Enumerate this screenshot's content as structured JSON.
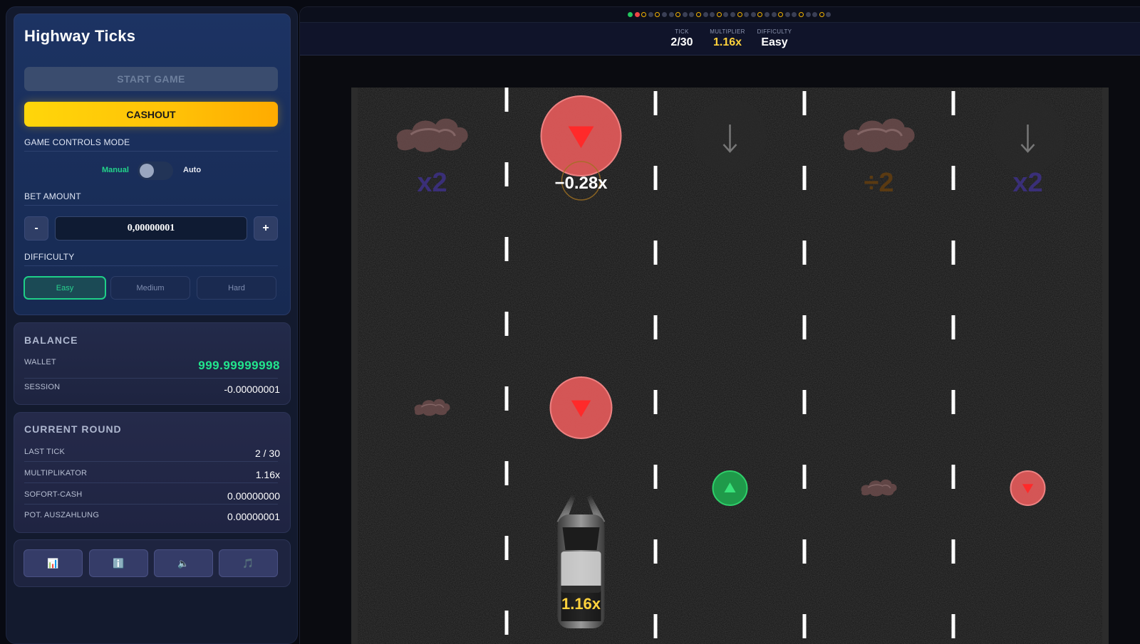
{
  "game": {
    "title": "Highway Ticks",
    "start_label": "START GAME",
    "cashout_label": "CASHOUT",
    "controls_mode_label": "GAME CONTROLS MODE",
    "mode_manual": "Manual",
    "mode_auto": "Auto",
    "mode_selected": "manual",
    "bet_amount_label": "BET AMOUNT",
    "bet_minus": "-",
    "bet_plus": "+",
    "bet_value": "0,00000001",
    "difficulty_label": "DIFFICULTY",
    "difficulties": [
      "Easy",
      "Medium",
      "Hard"
    ],
    "difficulty_selected": "Easy"
  },
  "balance": {
    "heading": "BALANCE",
    "wallet_label": "WALLET",
    "wallet_value": "999.99999998",
    "session_label": "SESSION",
    "session_value": "-0.00000001"
  },
  "round": {
    "heading": "CURRENT ROUND",
    "last_tick_label": "LAST TICK",
    "last_tick_value": "2 / 30",
    "multiplier_label": "MULTIPLIKATOR",
    "multiplier_value": "1.16x",
    "instant_cash_label": "SOFORT-CASH",
    "instant_cash_value": "0.00000000",
    "payout_label": "POT. AUSZAHLUNG",
    "payout_value": "0.00000001"
  },
  "tools": [
    {
      "name": "stats-button",
      "icon": "bar-chart-icon",
      "glyph": "📊"
    },
    {
      "name": "info-button",
      "icon": "info-icon",
      "glyph": "ℹ️"
    },
    {
      "name": "sound-button",
      "icon": "speaker-icon",
      "glyph": "🔈"
    },
    {
      "name": "music-button",
      "icon": "music-note-icon",
      "glyph": "🎵"
    }
  ],
  "hud": {
    "tick_label": "TICK",
    "tick_value": "2/30",
    "multiplier_label": "MULTIPLIER",
    "multiplier_value": "1.16x",
    "difficulty_label": "DIFFICULTY",
    "difficulty_value": "Easy"
  },
  "progress": {
    "total_ticks": 30,
    "states": [
      "won",
      "lost",
      "pending-gold",
      "empty",
      "pending-gold",
      "empty",
      "empty",
      "pending-gold",
      "empty",
      "empty",
      "pending-gold",
      "empty",
      "empty",
      "pending-gold",
      "empty",
      "empty",
      "pending-gold",
      "empty",
      "empty",
      "pending-gold",
      "empty",
      "empty",
      "pending-gold",
      "empty",
      "empty",
      "pending-gold",
      "empty",
      "empty",
      "pending-gold",
      "empty"
    ],
    "colors": {
      "won": "#22c55e",
      "lost": "#ef4444",
      "pending-gold": "#f5b400",
      "empty": "#3a3f55"
    }
  },
  "road": {
    "lane_count": 5,
    "items": [
      {
        "lane": 0,
        "row": 0,
        "type": "oil",
        "label": "x2",
        "label_color": "#3a2f78"
      },
      {
        "lane": 1,
        "row": 0,
        "type": "hazard-red",
        "label": "−0.28x",
        "label_color": "#ffffff"
      },
      {
        "lane": 2,
        "row": 0,
        "type": "arrow-ghost"
      },
      {
        "lane": 3,
        "row": 0,
        "type": "oil",
        "label": "÷2",
        "label_color": "#5a3a12"
      },
      {
        "lane": 4,
        "row": 0,
        "type": "arrow-ghost",
        "label": "x2",
        "label_color": "#3a2f78"
      },
      {
        "lane": 0,
        "row": 1,
        "type": "oil-small"
      },
      {
        "lane": 1,
        "row": 1,
        "type": "hazard-red"
      },
      {
        "lane": 2,
        "row": 2,
        "type": "boost-green"
      },
      {
        "lane": 3,
        "row": 2,
        "type": "oil-small"
      },
      {
        "lane": 4,
        "row": 2,
        "type": "hazard-red-small"
      }
    ],
    "car_lane": 1,
    "car_multiplier": "1.16x",
    "colors": {
      "asphalt": "#121212",
      "edge": "#2c2c2c",
      "marking": "#ffffff",
      "hazard": "#e35a5a",
      "boost": "#1f9a4a",
      "car_label": "#ffd23c"
    }
  }
}
